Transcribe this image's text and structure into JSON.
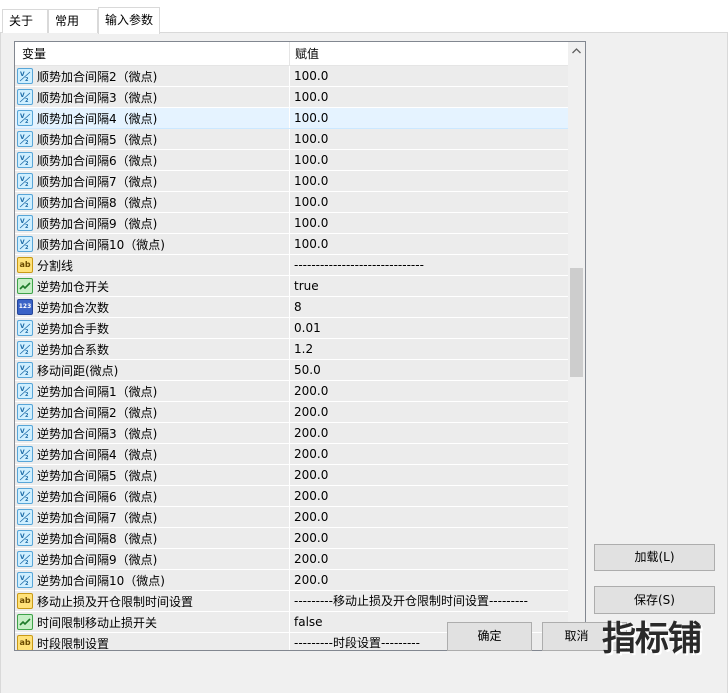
{
  "tabs": [
    {
      "label": "关于"
    },
    {
      "label": "常用"
    },
    {
      "label": "输入参数"
    }
  ],
  "grid": {
    "col_name": "变量",
    "col_value": "赋值",
    "rows": [
      {
        "icon": "double-value-icon",
        "name": "顺势加合间隔2（微点)",
        "value": "100.0"
      },
      {
        "icon": "double-value-icon",
        "name": "顺势加合间隔3（微点)",
        "value": "100.0"
      },
      {
        "icon": "double-value-icon",
        "name": "顺势加合间隔4（微点)",
        "value": "100.0"
      },
      {
        "icon": "double-value-icon",
        "name": "顺势加合间隔5（微点)",
        "value": "100.0"
      },
      {
        "icon": "double-value-icon",
        "name": "顺势加合间隔6（微点)",
        "value": "100.0"
      },
      {
        "icon": "double-value-icon",
        "name": "顺势加合间隔7（微点)",
        "value": "100.0"
      },
      {
        "icon": "double-value-icon",
        "name": "顺势加合间隔8（微点)",
        "value": "100.0"
      },
      {
        "icon": "double-value-icon",
        "name": "顺势加合间隔9（微点)",
        "value": "100.0"
      },
      {
        "icon": "double-value-icon",
        "name": "顺势加合间隔10（微点)",
        "value": "100.0"
      },
      {
        "icon": "string-value-icon",
        "name": "分割线",
        "value": "------------------------------"
      },
      {
        "icon": "bool-value-icon",
        "name": "逆势加仓开关",
        "value": "true"
      },
      {
        "icon": "int-value-icon",
        "name": "逆势加合次数",
        "value": "8"
      },
      {
        "icon": "double-value-icon",
        "name": "逆势加合手数",
        "value": "0.01"
      },
      {
        "icon": "double-value-icon",
        "name": "逆势加合系数",
        "value": "1.2"
      },
      {
        "icon": "double-value-icon",
        "name": "移动间距(微点)",
        "value": "50.0"
      },
      {
        "icon": "double-value-icon",
        "name": "逆势加合间隔1（微点)",
        "value": "200.0"
      },
      {
        "icon": "double-value-icon",
        "name": "逆势加合间隔2（微点)",
        "value": "200.0"
      },
      {
        "icon": "double-value-icon",
        "name": "逆势加合间隔3（微点)",
        "value": "200.0"
      },
      {
        "icon": "double-value-icon",
        "name": "逆势加合间隔4（微点)",
        "value": "200.0"
      },
      {
        "icon": "double-value-icon",
        "name": "逆势加合间隔5（微点)",
        "value": "200.0"
      },
      {
        "icon": "double-value-icon",
        "name": "逆势加合间隔6（微点)",
        "value": "200.0"
      },
      {
        "icon": "double-value-icon",
        "name": "逆势加合间隔7（微点)",
        "value": "200.0"
      },
      {
        "icon": "double-value-icon",
        "name": "逆势加合间隔8（微点)",
        "value": "200.0"
      },
      {
        "icon": "double-value-icon",
        "name": "逆势加合间隔9（微点)",
        "value": "200.0"
      },
      {
        "icon": "double-value-icon",
        "name": "逆势加合间隔10（微点)",
        "value": "200.0"
      },
      {
        "icon": "string-value-icon",
        "name": "移动止损及开仓限制时间设置",
        "value": "---------移动止损及开仓限制时间设置---------"
      },
      {
        "icon": "bool-value-icon",
        "name": "时间限制移动止损开关",
        "value": "false"
      },
      {
        "icon": "string-value-icon",
        "name": "时段限制设置",
        "value": "---------时段设置---------"
      }
    ]
  },
  "buttons": {
    "load": "加载(L)",
    "save": "保存(S)",
    "ok": "确定",
    "cancel": "取消"
  },
  "watermark": "指标铺",
  "colors": {
    "row_bg": "#ececec",
    "row_highlight": "#e5f3ff",
    "dialog_bg": "#f0f0f0"
  }
}
